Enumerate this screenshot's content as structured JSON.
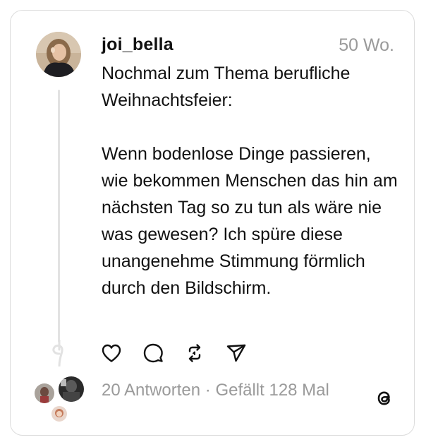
{
  "post": {
    "username": "joi_bella",
    "time": "50 Wo.",
    "paragraphs": [
      "Nochmal zum Thema berufliche Weihnachtsfeier:",
      "Wenn bodenlose Dinge passieren, wie bekommen Menschen das hin am nächsten Tag so zu tun als wäre nie was gewesen? Ich spüre diese unangenehme Stimmung förmlich durch den Bildschirm."
    ]
  },
  "actions": [
    "heart-icon",
    "comment-icon",
    "repost-icon",
    "share-icon"
  ],
  "stats": {
    "replies": "20 Antworten",
    "separator": " · ",
    "likes": "Gefällt 128 Mal"
  },
  "colors": {
    "text": "#111111",
    "muted": "#9a9a9a",
    "border": "#dcdcdc",
    "thread_line": "#e2e2e2"
  }
}
